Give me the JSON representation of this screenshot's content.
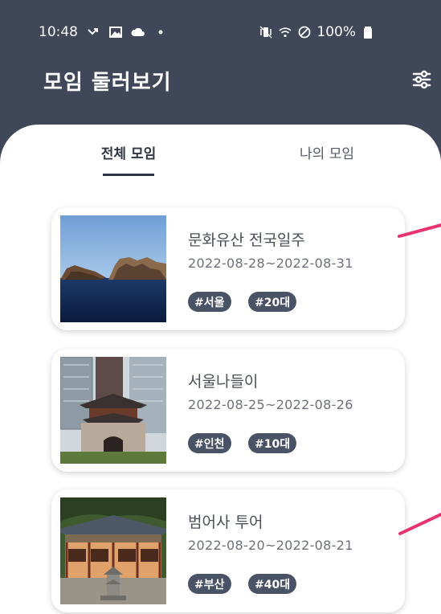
{
  "status_bar": {
    "time": "10:48",
    "battery": "100%",
    "icons_left": [
      "missed-call-icon",
      "image-icon",
      "cloud-icon",
      "dot-icon"
    ],
    "icons_right": [
      "vibrate-mute-icon",
      "wifi-icon",
      "block-icon",
      "battery-icon"
    ]
  },
  "app_bar": {
    "title": "모임 둘러보기",
    "filter_icon": "sliders-icon"
  },
  "tabs": [
    {
      "label": "전체 모임",
      "selected": true
    },
    {
      "label": "나의 모임",
      "selected": false
    }
  ],
  "meetups": [
    {
      "title": "문화유산 전국일주",
      "dates": "2022-08-28~2022-08-31",
      "tags": [
        "#서울",
        "#20대"
      ],
      "image": "coastal-rocks-photo"
    },
    {
      "title": "서울나들이",
      "dates": "2022-08-25~2022-08-26",
      "tags": [
        "#인천",
        "#10대"
      ],
      "image": "city-gate-photo"
    },
    {
      "title": "범어사 투어",
      "dates": "2022-08-20~2022-08-21",
      "tags": [
        "#부산",
        "#40대"
      ],
      "image": "temple-photo"
    }
  ],
  "colors": {
    "header_bg": "#3f4759",
    "tag_bg": "#4a5266",
    "accent_pink": "#e8336f"
  }
}
